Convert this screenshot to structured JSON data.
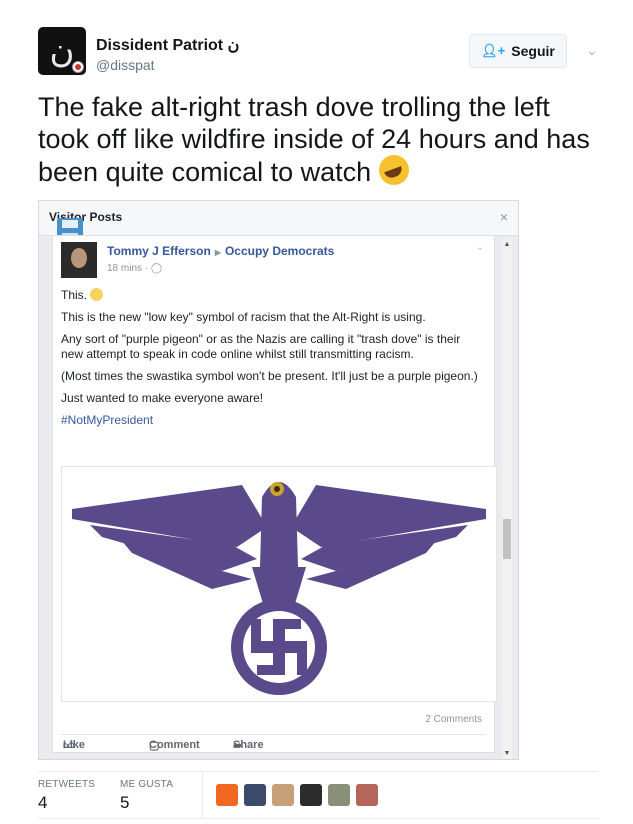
{
  "author": {
    "name": "Dissident Patriot ن",
    "handle": "@disspat"
  },
  "follow": {
    "label": "Seguir"
  },
  "tweet": {
    "text": "The fake alt-right trash dove trolling the left took off like wildfire inside of 24 hours and has been quite comical to watch"
  },
  "embedded": {
    "panel_title": "Visitor Posts",
    "close": "×",
    "post": {
      "author": "Tommy J Efferson",
      "target": "Occupy Democrats",
      "time": "18 mins",
      "lines": [
        "This.",
        "This is the new \"low key\" symbol of racism that the Alt-Right is using.",
        "Any sort of \"purple pigeon\" or as the Nazis are calling it \"trash dove\" is their new attempt to speak in code online whilst still transmitting racism.",
        "(Most times the swastika symbol won't be present. It'll just be a purple pigeon.)",
        "Just wanted to make everyone aware!"
      ],
      "hashtag": "#NotMyPresident",
      "comments": "2 Comments",
      "actions": {
        "like": "Like",
        "comment": "Comment",
        "share": "Share"
      }
    }
  },
  "stats": {
    "retweets_label": "RETWEETS",
    "retweets": "4",
    "likes_label": "ME GUSTA",
    "likes": "5"
  },
  "colors": {
    "brand": "#1da1f2",
    "fb_link": "#365899",
    "eagle_purple": "#5a4a8c"
  }
}
